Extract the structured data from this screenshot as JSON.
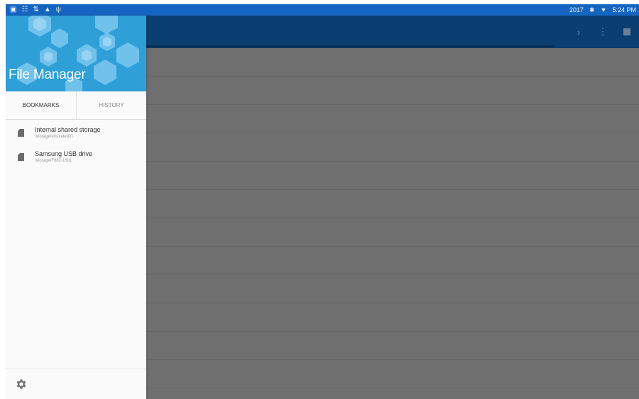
{
  "status_bar": {
    "left_icons": [
      "image-icon",
      "sim-icon",
      "transfer-icon",
      "warning-icon",
      "usb-icon"
    ],
    "year": "2017",
    "time": "5:24 PM"
  },
  "app_bar": {
    "action_icons": [
      "chevron-right-icon",
      "more-vert-icon",
      "square-icon"
    ]
  },
  "drawer": {
    "title": "File Manager",
    "tabs": [
      {
        "label": "BOOKMARKS",
        "selected": true
      },
      {
        "label": "HISTORY",
        "selected": false
      }
    ],
    "bookmarks": [
      {
        "name": "Internal shared storage",
        "path": "/storage/emulated/0"
      },
      {
        "name": "Samsung USB drive",
        "path": "/storage/F882-1601"
      }
    ]
  },
  "colors": {
    "status_bar": "#1565c0",
    "app_bar": "#0b3f72",
    "drawer_header": "#2f9fd8",
    "scrim_background": "#6f6f6f"
  }
}
